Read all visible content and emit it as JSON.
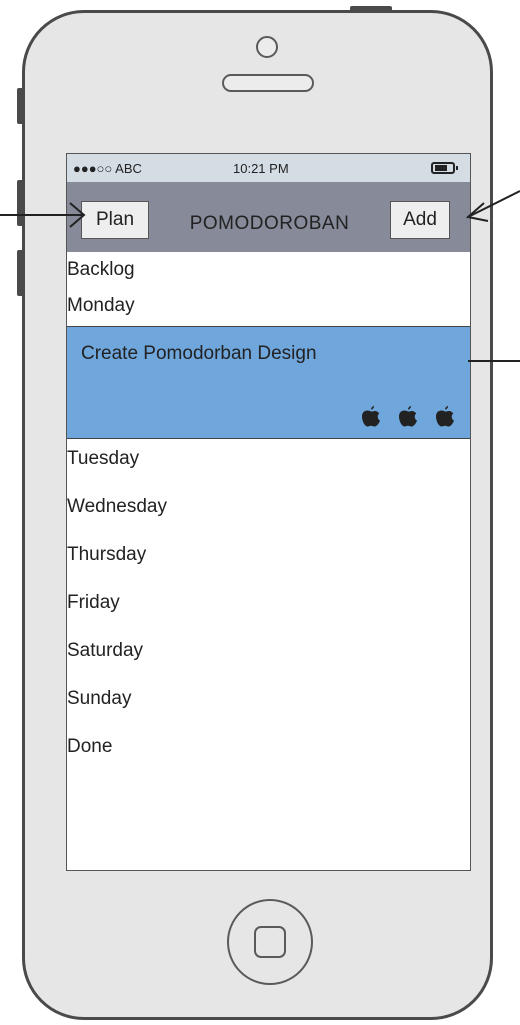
{
  "status_bar": {
    "carrier": "●●●○○ ABC",
    "time": "10:21 PM",
    "battery_icon": "battery-icon"
  },
  "nav": {
    "left_button": "Plan",
    "title": "POMODOROBAN",
    "right_button": "Add"
  },
  "list": {
    "before_card": [
      "Backlog",
      "Monday"
    ],
    "card": {
      "title": "Create Pomodorban Design",
      "pomodoro_icons": [
        "apple-icon",
        "apple-icon",
        "apple-icon"
      ],
      "pomodoro_count": 3
    },
    "after_card": [
      "Tuesday",
      "Wednesday",
      "Thursday",
      "Friday",
      "Saturday",
      "Sunday",
      "Done"
    ]
  },
  "colors": {
    "nav_bar": "#868a99",
    "status_bar": "#d4dde4",
    "card": "#6fa6dc",
    "phone_body": "#e6e6e6"
  }
}
